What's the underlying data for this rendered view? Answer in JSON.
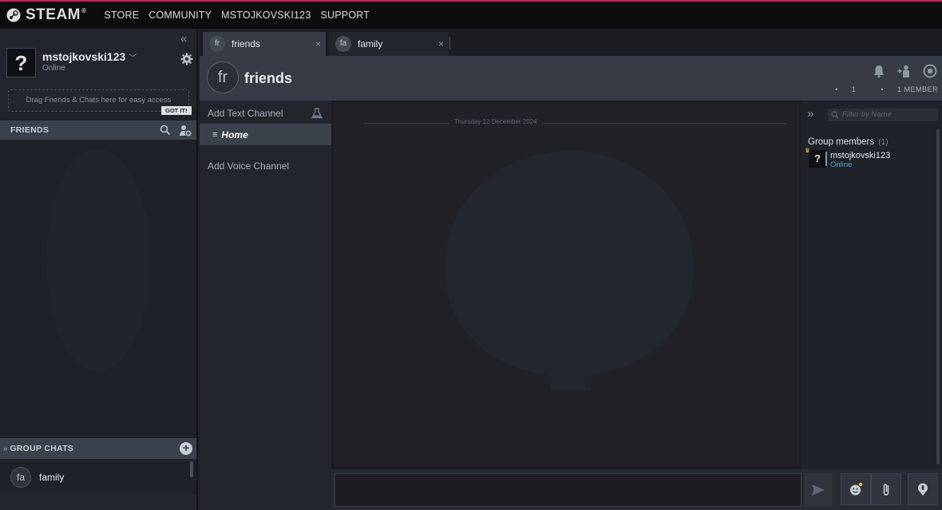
{
  "topbar": {
    "logo_text": "STEAM",
    "logo_reg": "®",
    "nav": [
      "STORE",
      "COMMUNITY",
      "MSTOJKOVSKI123",
      "SUPPORT"
    ]
  },
  "user": {
    "avatar_glyph": "?",
    "name": "mstojkovski123",
    "status": "Online"
  },
  "left": {
    "collapse_glyph": "«",
    "drop_hint": "Drag Friends & Chats here for easy access",
    "got_it": "GOT IT!",
    "friends_header": "FRIENDS",
    "group_chats_header": "GROUP CHATS",
    "group_chats_chevron": "»",
    "group_chats_add": "+",
    "groups": [
      {
        "avatar": "fa",
        "name": "family"
      }
    ]
  },
  "tabs": [
    {
      "avatar": "fr",
      "name": "friends",
      "close": "×",
      "active": true
    },
    {
      "avatar": "fa",
      "name": "family",
      "close": "×",
      "active": false
    }
  ],
  "chat": {
    "avatar": "fr",
    "name": "friends",
    "online_count": "1",
    "member_count": "1 MEMBER",
    "bullet": "•"
  },
  "channels": {
    "add_text": "Add Text Channel",
    "home_icon": "≡",
    "home": "Home",
    "add_voice": "Add Voice Channel"
  },
  "messages": {
    "date": "Thursday 12 December 2024"
  },
  "members": {
    "expand_glyph": "»",
    "filter_placeholder": "Filter by Name",
    "group_label": "Group members",
    "group_count": "(1)",
    "crown_glyph": "♛",
    "list": [
      {
        "avatar": "?",
        "name": "mstojkovski123",
        "status": "Online"
      }
    ]
  },
  "colors": {
    "accent_top": "#c4245a",
    "online": "#57a4c9"
  }
}
